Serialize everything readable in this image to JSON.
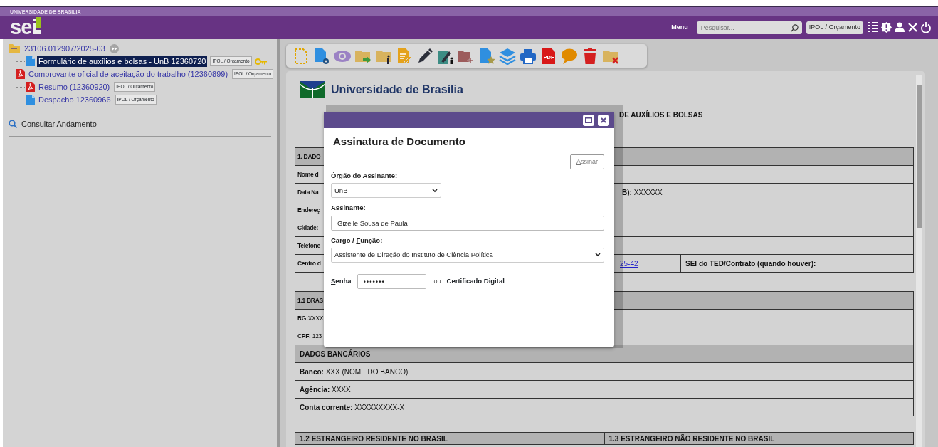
{
  "header": {
    "org": "UNIVERSIDADE DE BRASILIA",
    "logo": "sei",
    "menu_label": "Menu",
    "search": {
      "placeholder": "Pesquisar..."
    },
    "unit": "IPOL / Orçamento"
  },
  "tree": {
    "root": "23106.012907/2025-03",
    "items": [
      {
        "kind": "doc",
        "label": "Formulário de auxílios e bolsas - UnB 12360720",
        "tag": "IPOL / Orçamento",
        "selected": true,
        "key": true
      },
      {
        "kind": "pdf",
        "label": "Comprovante oficial de aceitação do trabalho (12360899)",
        "tag": "IPOL / Orçamento",
        "selected": false,
        "key": false
      },
      {
        "kind": "pdf",
        "label": "Resumo (12360920)",
        "tag": "IPOL / Orçamento",
        "selected": false,
        "key": false
      },
      {
        "kind": "doc",
        "label": "Despacho 12360966",
        "tag": "IPOL / Orçamento",
        "selected": false,
        "key": false
      }
    ]
  },
  "consult": "Consultar Andamento",
  "toolbar": [
    {
      "kind": "new-document"
    },
    {
      "kind": "document-gear"
    },
    {
      "kind": "eye"
    },
    {
      "kind": "folder-arrow"
    },
    {
      "kind": "folder-info"
    },
    {
      "kind": "document-pen"
    },
    {
      "kind": "pen"
    },
    {
      "kind": "building-pen"
    },
    {
      "kind": "folder-plus"
    },
    {
      "kind": "document-star"
    },
    {
      "kind": "layers"
    },
    {
      "kind": "printer"
    },
    {
      "kind": "pdf",
      "label": "PDF"
    },
    {
      "kind": "speech"
    },
    {
      "kind": "trash"
    },
    {
      "kind": "folder-x"
    }
  ],
  "document": {
    "university": "Universidade de Brasília",
    "title_part": "DE AUXÍLIOS E BOLSAS",
    "tables": [
      {
        "rows": [
          {
            "kind": "header",
            "stub": "1. DADO"
          },
          {
            "kind": "field",
            "stub": "Nome d"
          },
          {
            "kind": "field",
            "stub": "Data Na",
            "right": "**B):** XXXXXX"
          },
          {
            "kind": "field",
            "stub": "Endereç"
          },
          {
            "kind": "field",
            "stub": "Cidade:"
          },
          {
            "kind": "field",
            "stub": "Telefone"
          },
          {
            "kind": "field",
            "stub": "Centro d",
            "link": "25-42",
            "right": "**SEI do TED/Contrato (quando houver):**"
          }
        ]
      },
      {
        "rows": [
          {
            "kind": "header",
            "stub": "1.1 BRAS"
          },
          {
            "kind": "field",
            "stub": "**RG:**XXXX"
          },
          {
            "kind": "field",
            "stub": "**CPF:** 123"
          },
          {
            "kind": "header",
            "text": "DADOS BANCÁRIOS"
          },
          {
            "kind": "field",
            "text": "**Banco:** XXX (NOME DO BANCO)"
          },
          {
            "kind": "field",
            "text": "**Agência:** XXXX"
          },
          {
            "kind": "field",
            "text": "**Conta corrente:** XXXXXXXXX-X"
          }
        ]
      },
      {
        "rows": [
          {
            "kind": "header",
            "cells": [
              "1.2 ESTRANGEIRO RESIDENTE NO BRASIL",
              "1.3 ESTRANGEIRO NÃO RESIDENTE NO BRASIL"
            ]
          }
        ]
      }
    ]
  },
  "modal": {
    "title": "Assinatura de Documento",
    "submit": {
      "key": "A",
      "after": "ssinar"
    },
    "org": {
      "before": "Ó",
      "key": "r",
      "after": "gão do Assinante:",
      "value": "UnB"
    },
    "signer": {
      "before": "Assinant",
      "key": "e",
      "after": ":",
      "value": "Gizelle Sousa de Paula"
    },
    "role": {
      "before": "Cargo / ",
      "key": "F",
      "after": "unção:",
      "value": "Assistente de Direção do Instituto de Ciência Política"
    },
    "password": {
      "key": "S",
      "after": "enha",
      "value": "•••••••"
    },
    "or": "ou",
    "certificate": "Certificado Digital"
  }
}
